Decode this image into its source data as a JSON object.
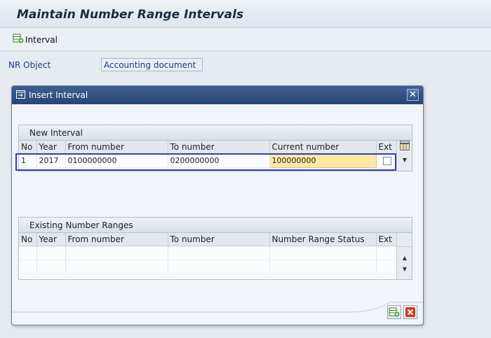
{
  "screen": {
    "title": "Maintain Number Range Intervals"
  },
  "toolbar": {
    "interval_label": "Interval"
  },
  "nr_object": {
    "label": "NR Object",
    "value": "Accounting document"
  },
  "dialog": {
    "title": "Insert Interval"
  },
  "new_interval": {
    "title": "New Interval",
    "columns": [
      "No",
      "Year",
      "From number",
      "To number",
      "Current number",
      "Ext"
    ],
    "row": {
      "no": "1",
      "year": "2017",
      "from": "0100000000",
      "to": "0200000000",
      "current": "100000000"
    }
  },
  "existing_ranges": {
    "title": "Existing Number Ranges",
    "columns": [
      "No",
      "Year",
      "From number",
      "To number",
      "Number Range Status",
      "Ext"
    ]
  },
  "icons": {
    "interval": "create-interval-icon",
    "dialog": "dialog-window-icon",
    "close": "close-icon",
    "column_settings": "table-settings-icon",
    "scroll_up": "scroll-up-icon",
    "scroll_down": "scroll-down-icon",
    "insert": "insert-icon",
    "cancel": "cancel-icon"
  },
  "colors": {
    "dialog_header": "#274576",
    "highlight_cell": "#fde9a3",
    "selection_border": "#2f3fb4",
    "cancel_red": "#d6391e"
  }
}
